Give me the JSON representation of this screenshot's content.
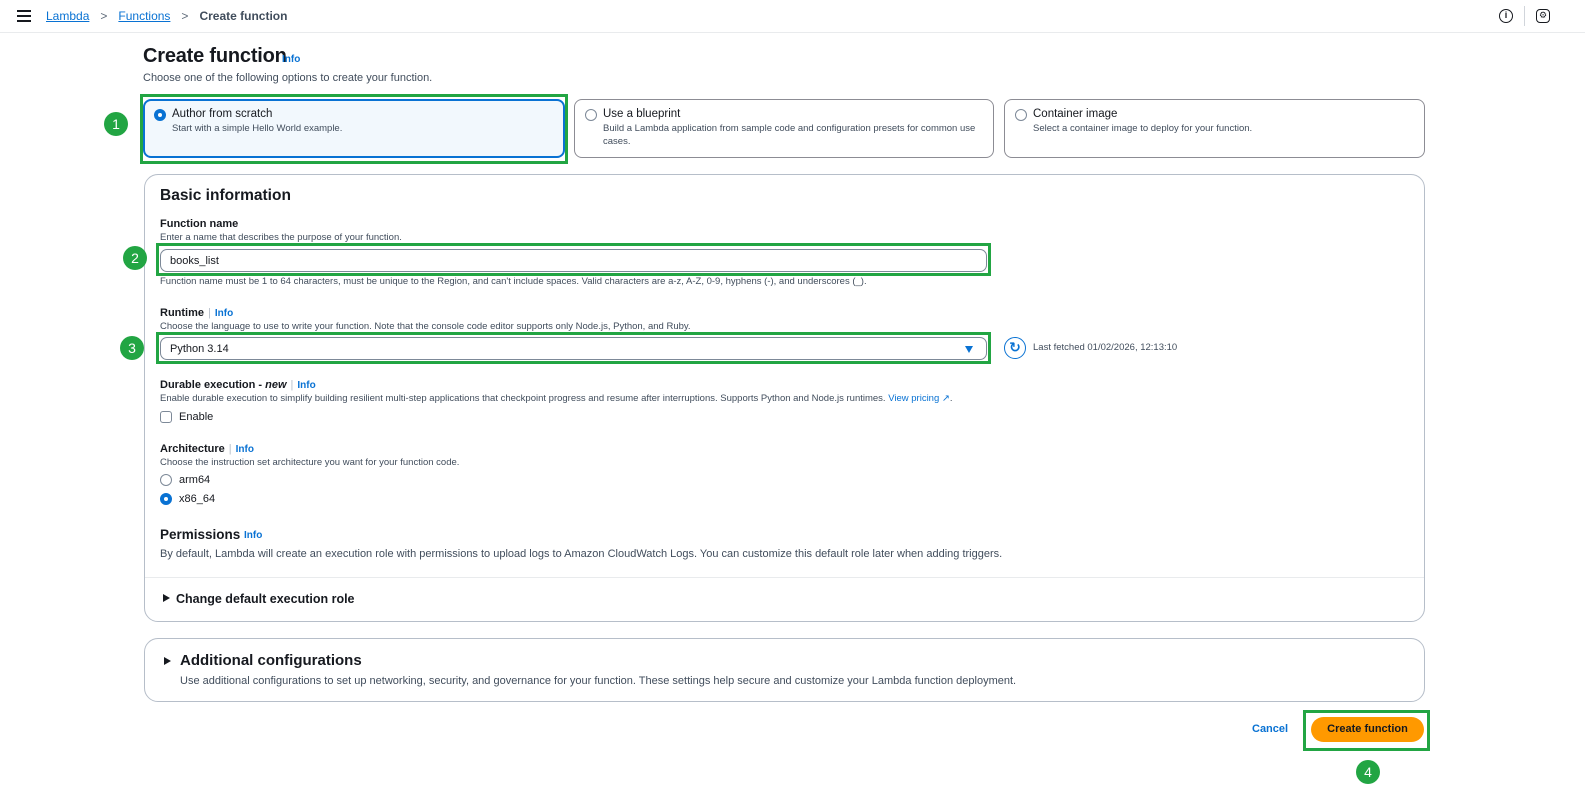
{
  "breadcrumb": {
    "items": [
      "Lambda",
      "Functions"
    ],
    "current": "Create function"
  },
  "page": {
    "title": "Create function",
    "info": "Info",
    "subtitle": "Choose one of the following options to create your function."
  },
  "options": [
    {
      "title": "Author from scratch",
      "desc": "Start with a simple Hello World example.",
      "selected": true
    },
    {
      "title": "Use a blueprint",
      "desc": "Build a Lambda application from sample code and configuration presets for common use cases.",
      "selected": false
    },
    {
      "title": "Container image",
      "desc": "Select a container image to deploy for your function.",
      "selected": false
    }
  ],
  "basic": {
    "title": "Basic information",
    "function_name": {
      "label": "Function name",
      "desc": "Enter a name that describes the purpose of your function.",
      "value": "books_list",
      "constraint": "Function name must be 1 to 64 characters, must be unique to the Region, and can't include spaces. Valid characters are a-z, A-Z, 0-9, hyphens (-), and underscores (_)."
    },
    "runtime": {
      "label": "Runtime",
      "info": "Info",
      "desc": "Choose the language to use to write your function. Note that the console code editor supports only Node.js, Python, and Ruby.",
      "value": "Python 3.14",
      "fetched": "Last fetched 01/02/2026, 12:13:10"
    },
    "durable": {
      "label_prefix": "Durable execution - ",
      "label_new": "new",
      "info": "Info",
      "desc": "Enable durable execution to simplify building resilient multi-step applications that checkpoint progress and resume after interruptions. Supports Python and Node.js runtimes.",
      "link": "View pricing",
      "checkbox_label": "Enable"
    },
    "architecture": {
      "label": "Architecture",
      "info": "Info",
      "desc": "Choose the instruction set architecture you want for your function code.",
      "options": [
        "arm64",
        "x86_64"
      ],
      "selected": "x86_64"
    },
    "permissions": {
      "title": "Permissions",
      "info": "Info",
      "desc": "By default, Lambda will create an execution role with permissions to upload logs to Amazon CloudWatch Logs. You can customize this default role later when adding triggers."
    },
    "change_role": "Change default execution role"
  },
  "additional": {
    "title": "Additional configurations",
    "desc": "Use additional configurations to set up networking, security, and governance for your function. These settings help secure and customize your Lambda function deployment."
  },
  "actions": {
    "cancel": "Cancel",
    "create": "Create function"
  },
  "annotations": [
    "1",
    "2",
    "3",
    "4"
  ],
  "colors": {
    "accent": "#0972d3",
    "primary_button": "#ff9900",
    "highlight": "#22a543"
  }
}
